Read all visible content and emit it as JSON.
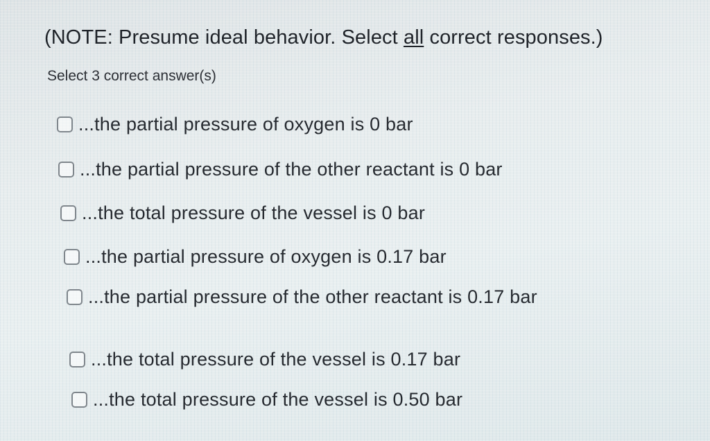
{
  "question": {
    "note_prefix": "(NOTE: Presume ideal behavior.  Select ",
    "note_emphasis": "all",
    "note_suffix": " correct responses.)",
    "instruction": "Select 3 correct answer(s)"
  },
  "options": [
    {
      "label": "...the partial pressure of oxygen is 0 bar",
      "checked": false
    },
    {
      "label": "...the partial pressure of the other reactant is 0 bar",
      "checked": false
    },
    {
      "label": "...the total pressure of the vessel is 0 bar",
      "checked": false
    },
    {
      "label": "...the partial pressure of oxygen is 0.17 bar",
      "checked": false
    },
    {
      "label": "...the partial pressure of the other reactant is 0.17 bar",
      "checked": false
    },
    {
      "label": "...the total pressure of the vessel is 0.17 bar",
      "checked": false
    },
    {
      "label": "...the total pressure of the vessel is 0.50 bar",
      "checked": false
    }
  ],
  "colors": {
    "text": "#262a30",
    "checkbox_border": "#7f868c",
    "background": "#e8edee"
  }
}
